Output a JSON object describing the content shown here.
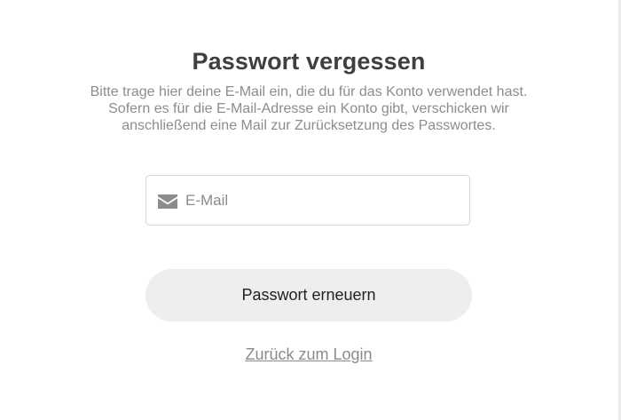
{
  "title": "Passwort vergessen",
  "description": {
    "line1": "Bitte trage hier deine E-Mail ein, die du für das Konto verwendet hast.",
    "line2": "Sofern es für die E-Mail-Adresse ein Konto gibt, verschicken wir",
    "line3": "anschließend eine Mail zur Zurücksetzung des Passwortes."
  },
  "email": {
    "icon": "envelope-icon",
    "placeholder": "E-Mail",
    "value": ""
  },
  "submit_label": "Passwort erneuern",
  "back_link_label": "Zurück zum Login",
  "colors": {
    "title": "#3f3f3f",
    "muted_text": "#8c8c8c",
    "button_bg": "#eeeef1",
    "input_border": "#d5d5d5"
  }
}
